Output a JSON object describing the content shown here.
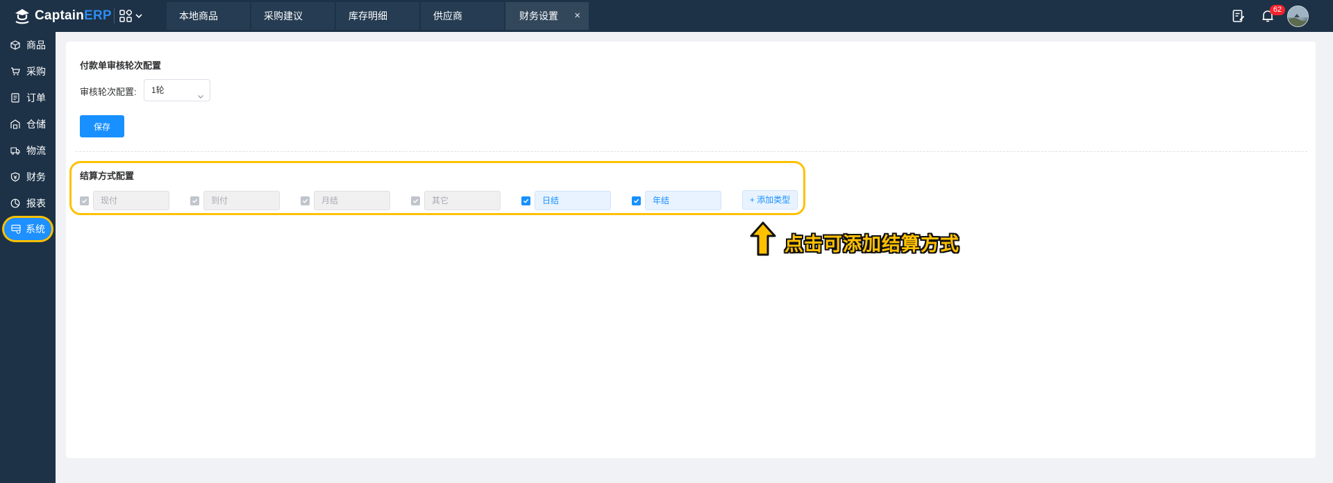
{
  "app": {
    "logo_main": "Captain",
    "logo_accent": "ERP"
  },
  "tabs": [
    {
      "label": "本地商品"
    },
    {
      "label": "采购建议"
    },
    {
      "label": "库存明细"
    },
    {
      "label": "供应商"
    },
    {
      "label": "财务设置",
      "active": true,
      "close": "×"
    }
  ],
  "header": {
    "notification_count": "62",
    "icons": [
      "edit-note-icon",
      "bell-icon",
      "avatar"
    ]
  },
  "sidebar": {
    "items": [
      {
        "label": "商品",
        "icon": "box-icon"
      },
      {
        "label": "采购",
        "icon": "cart-icon"
      },
      {
        "label": "订单",
        "icon": "order-icon"
      },
      {
        "label": "仓储",
        "icon": "warehouse-icon"
      },
      {
        "label": "物流",
        "icon": "truck-icon"
      },
      {
        "label": "财务",
        "icon": "finance-icon"
      },
      {
        "label": "报表",
        "icon": "chart-pie-icon"
      },
      {
        "label": "系统",
        "icon": "system-icon",
        "active": true
      }
    ]
  },
  "payment_review": {
    "title": "付款单审核轮次配置",
    "rounds_label": "审核轮次配置:",
    "rounds_value": "1轮",
    "save_label": "保存"
  },
  "settlement": {
    "title": "结算方式配置",
    "items": [
      {
        "label": "现付",
        "checked": true,
        "disabled": true
      },
      {
        "label": "到付",
        "checked": true,
        "disabled": true
      },
      {
        "label": "月结",
        "checked": true,
        "disabled": true
      },
      {
        "label": "其它",
        "checked": true,
        "disabled": true
      },
      {
        "label": "日结",
        "checked": true,
        "disabled": false
      },
      {
        "label": "年结",
        "checked": true,
        "disabled": false
      }
    ],
    "add_label": "+ 添加类型"
  },
  "annotation": {
    "text": "点击可添加结算方式"
  },
  "colors": {
    "topbar": "#1d3247",
    "accent": "#1890ff",
    "highlight": "#ffc000",
    "badge": "#f5222d"
  }
}
